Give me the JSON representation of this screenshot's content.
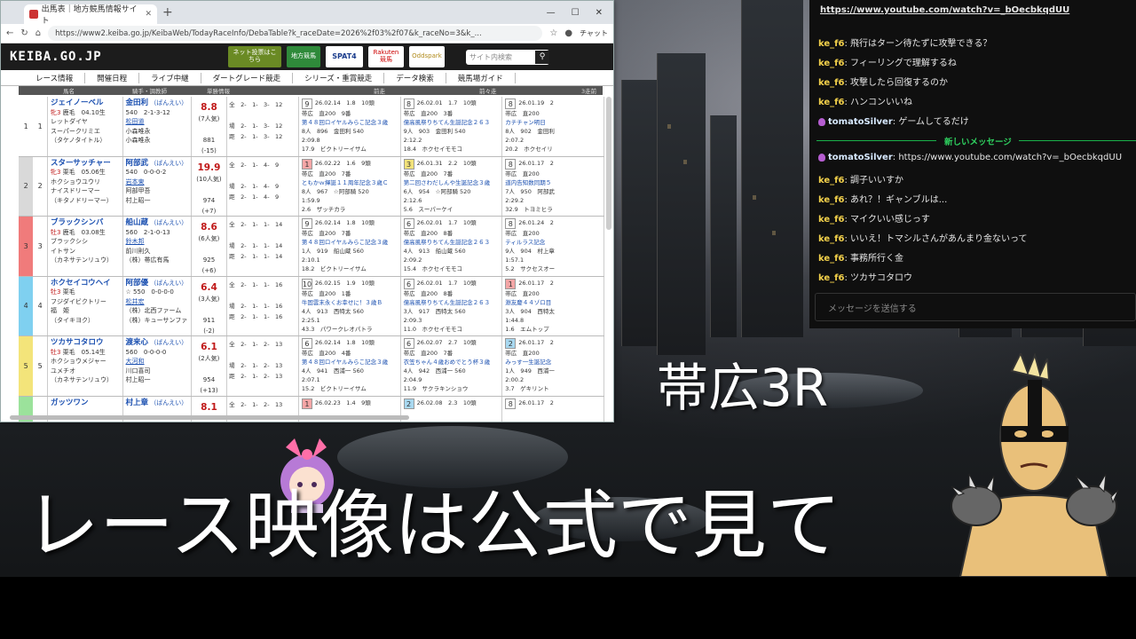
{
  "browser": {
    "tab_title": "出馬表｜地方競馬情報サイト",
    "url": "https://www2.keiba.go.jp/KeibaWeb/TodayRaceInfo/DebaTable?k_raceDate=2026%2f03%2f07&k_raceNo=3&k_...",
    "chat_label": "チャット"
  },
  "site": {
    "logo": "KEIBA.GO.JP",
    "banners": [
      "ネット投票はこちら",
      "地方競馬",
      "SPAT4",
      "Rakuten 競馬",
      "Oddspark"
    ],
    "search_placeholder": "サイト内検索",
    "nav": [
      "レース情報",
      "開催日程",
      "ライブ中継",
      "ダートグレード競走",
      "シリーズ・重賞競走",
      "データ検索",
      "競馬場ガイド"
    ],
    "table_head": [
      "馬名",
      "騎手・調教師",
      "単勝情報",
      "前走",
      "前々走",
      "3走前"
    ]
  },
  "horses": [
    {
      "waku": "1",
      "num": "1",
      "name": "ジェイノーベル",
      "sex_age": "牝3",
      "color_date": "鹿毛　04.10生",
      "sire": "レットダイヤ",
      "dam": "スーパークリミエ",
      "damsire": "（タケノタイトル）",
      "jockey": "金田利",
      "jkana": "（ばんえい）",
      "weight": "540　2-1-3-12",
      "trainer": "松田道",
      "owner": "小森唯永",
      "breeder": "小森唯永",
      "odds": "8.8",
      "pop": "(7人気)",
      "bw": "881",
      "bwd": "(-15)",
      "rec": "全　2-　1-　3-　12\n\n場　2-　1-　3-　12\n距　2-　1-　3-　12",
      "p1": {
        "n": "9",
        "c": "#ffffff",
        "d": "26.02.14　1.8　10頭",
        "t": "帯広　直200　9番",
        "race": "第４８回ロイヤルみらこ記念３歳",
        "w": "8人　896　金田利 540",
        "time": "2:09.8",
        "win": "17.9　ビクトリーイサム"
      },
      "p2": {
        "n": "8",
        "c": "#ffffff",
        "d": "26.02.01　1.7　10頭",
        "t": "帯広　直200　3番",
        "race": "億高風祭りちてん生誕記念２６３",
        "w": "9人　903　金田利 540",
        "time": "2:12.2",
        "win": "18.4　ホクセイモモコ"
      },
      "p3": {
        "n": "8",
        "c": "#ffffff",
        "d": "26.01.19　2",
        "t": "帯広　直200",
        "race": "カチチャン明日",
        "w": "8人　902　金田利",
        "time": "2:07.2",
        "win": "20.2　ホクセイリ"
      }
    },
    {
      "waku": "2",
      "num": "2",
      "name": "スターサッチャー",
      "sex_age": "牝3",
      "color_date": "栗毛　05.06生",
      "sire": "ホクショウユウリ",
      "dam": "ナイスドリーマー",
      "damsire": "（キタノドリーマー）",
      "jockey": "阿部武",
      "jkana": "（ばんえい）",
      "weight": "540　0-0-0-2",
      "trainer": "岩本東",
      "owner": "阿部甲吾",
      "breeder": "村上昭一",
      "odds": "19.9",
      "pop": "(10人気)",
      "bw": "974",
      "bwd": "(+7)",
      "rec": "全　2-　1-　4-　9\n\n場　2-　1-　4-　9\n距　2-　1-　4-　9",
      "p1": {
        "n": "1",
        "c": "#f4a6a6",
        "d": "26.02.22　1.6　9頭",
        "t": "帯広　直200　7番",
        "race": "ともかｗ揮誕１１周年記念３歳Ｃ",
        "w": "8人　967　☆阿部騎 520",
        "time": "1:59.9",
        "win": "2.6　ザッチカラ"
      },
      "p2": {
        "n": "3",
        "c": "#f2e27a",
        "d": "26.01.31　2.2　10頭",
        "t": "帯広　直200　7番",
        "race": "第二回さわだしんや生誕記念３歳",
        "w": "6人　954　☆阿部騎 520",
        "time": "2:12.6",
        "win": "5.6　スーパーケイ"
      },
      "p3": {
        "n": "8",
        "c": "#ffffff",
        "d": "26.01.17　2",
        "t": "帯広　直200",
        "race": "道内告知数同期５",
        "w": "7人　950　阿部武",
        "time": "2:29.2",
        "win": "32.9　トヨミヒラ"
      }
    },
    {
      "waku": "3",
      "num": "3",
      "name": "ブラックシンバ",
      "sex_age": "牡3",
      "color_date": "鹿毛　03.08生",
      "sire": "ブラックシシ",
      "dam": "イトサン",
      "damsire": "（カネサテンリュウ）",
      "jockey": "船山蔵",
      "jkana": "（ばんえい）",
      "weight": "560　2-1-0-13",
      "trainer": "鈴木邦",
      "owner": "前川則久",
      "breeder": "（株）帯広有馬",
      "odds": "8.6",
      "pop": "(6人気)",
      "bw": "925",
      "bwd": "(+6)",
      "rec": "全　2-　1-　1-　14\n\n場　2-　1-　1-　14\n距　2-　1-　1-　14",
      "p1": {
        "n": "9",
        "c": "#ffffff",
        "d": "26.02.14　1.8　10頭",
        "t": "帯広　直200　7番",
        "race": "第４８回ロイヤルみらこ記念３歳",
        "w": "1人　919　船山蔵 560",
        "time": "2:10.1",
        "win": "18.2　ビクトリーイサム"
      },
      "p2": {
        "n": "6",
        "c": "#ffffff",
        "d": "26.02.01　1.7　10頭",
        "t": "帯広　直200　8番",
        "race": "億高風祭りちてん生誕記念２６３",
        "w": "4人　913　船山蔵 560",
        "time": "2:09.2",
        "win": "15.4　ホクセイモモコ"
      },
      "p3": {
        "n": "8",
        "c": "#ffffff",
        "d": "26.01.24　2",
        "t": "帯広　直200",
        "race": "ティルラス記念",
        "w": "9人　904　村上章",
        "time": "1:57.1",
        "win": "5.2　サクセスオー"
      }
    },
    {
      "waku": "4",
      "num": "4",
      "name": "ホクセイコウヘイ",
      "sex_age": "牡3",
      "color_date": "栗毛",
      "sire": "フジダイビクトリー",
      "dam": "福　姫",
      "damsire": "（タイキヨク）",
      "jockey": "阿部優",
      "jkana": "（ばんえい）",
      "weight": "☆ 550　0-0-0-0",
      "trainer": "松井宏",
      "owner": "（株）北西ファーム",
      "breeder": "（株）キューサンファ",
      "odds": "6.4",
      "pop": "(3人気)",
      "bw": "911",
      "bwd": "(-2)",
      "rec": "全　2-　1-　1-　16\n\n場　2-　1-　1-　16\n距　2-　1-　1-　16",
      "p1": {
        "n": "10",
        "c": "#ffffff",
        "d": "26.02.15　1.9　10頭",
        "t": "帯広　直200　1番",
        "race": "牛固雲末永くお幸せに！３歳Ｂ",
        "w": "4人　913　西特太 560",
        "time": "2:25.1",
        "win": "43.3　パワークレオパトラ"
      },
      "p2": {
        "n": "6",
        "c": "#ffffff",
        "d": "26.02.01　1.7　10頭",
        "t": "帯広　直200　8番",
        "race": "億高風祭りちてん生誕記念２６３",
        "w": "3人　917　西特太 560",
        "time": "2:09.3",
        "win": "11.0　ホクセイモモコ"
      },
      "p3": {
        "n": "1",
        "c": "#f4a6a6",
        "d": "26.01.17　2",
        "t": "帯広　直200",
        "race": "淵友慶４４ゾロ目",
        "w": "3人　904　西特太",
        "time": "1:44.8",
        "win": "1.6　エムトップ"
      }
    },
    {
      "waku": "5",
      "num": "5",
      "name": "ツカサコタロウ",
      "sex_age": "牡3",
      "color_date": "栗毛　05.14生",
      "sire": "ホクショウメジャー",
      "dam": "ユメチオ",
      "damsire": "（カネサテンリュウ）",
      "jockey": "渡来心",
      "jkana": "（ばんえい）",
      "weight": "560　0-0-0-0",
      "trainer": "大河和",
      "owner": "川口喜司",
      "breeder": "村上昭一",
      "odds": "6.1",
      "pop": "(2人気)",
      "bw": "954",
      "bwd": "(+13)",
      "rec": "全　2-　1-　2-　13\n\n場　2-　1-　2-　13\n距　2-　1-　2-　13",
      "p1": {
        "n": "6",
        "c": "#ffffff",
        "d": "26.02.14　1.8　10頭",
        "t": "帯広　直200　4番",
        "race": "第４８回ロイヤルみらこ記念３歳",
        "w": "4人　941　西浦一 560",
        "time": "2:07.1",
        "win": "15.2　ビクトリーイサム"
      },
      "p2": {
        "n": "6",
        "c": "#ffffff",
        "d": "26.02.07　2.7　10頭",
        "t": "帯広　直200　7番",
        "race": "衣笠ちゃん４歳おめでとう杯３歳",
        "w": "4人　942　西浦一 560",
        "time": "2:04.9",
        "win": "11.9　サクラキンショウ"
      },
      "p3": {
        "n": "2",
        "c": "#a8d8f0",
        "d": "26.01.17　2",
        "t": "帯広　直200",
        "race": "みっす一生誕記念",
        "w": "1人　949　西浦一",
        "time": "2:00.2",
        "win": "3.7　ゲキリント"
      }
    },
    {
      "waku": "6",
      "num": "6",
      "name": "ガッツワン",
      "sex_age": "",
      "color_date": "",
      "sire": "",
      "dam": "",
      "damsire": "",
      "jockey": "村上章",
      "jkana": "（ばんえい）",
      "weight": "",
      "trainer": "",
      "owner": "",
      "breeder": "",
      "odds": "8.1",
      "pop": "",
      "bw": "",
      "bwd": "",
      "rec": "全　2-　1-　2-　13",
      "p1": {
        "n": "1",
        "c": "#f4a6a6",
        "d": "26.02.23　1.4　9頭",
        "t": "",
        "race": "",
        "w": "",
        "time": "",
        "win": ""
      },
      "p2": {
        "n": "2",
        "c": "#a8d8f0",
        "d": "26.02.08　2.3　10頭",
        "t": "",
        "race": "",
        "w": "",
        "time": "",
        "win": ""
      },
      "p3": {
        "n": "8",
        "c": "#ffffff",
        "d": "26.01.17　2",
        "t": "",
        "race": "",
        "w": "",
        "time": "",
        "win": ""
      }
    }
  ],
  "chat": {
    "top_link": "https://www.youtube.com/watch?v=_bOecbkqdUU",
    "messages": [
      {
        "user": "ke_f6",
        "text": "飛行はターン待たずに攻撃できる？"
      },
      {
        "user": "ke_f6",
        "text": "フィーリングで理解するね"
      },
      {
        "user": "ke_f6",
        "text": "攻撃したら回復するのか"
      },
      {
        "user": "ke_f6",
        "text": "ハンコンいいね"
      },
      {
        "user": "tomatoSilver",
        "text": "ゲームしてるだけ"
      }
    ],
    "divider": "新しいメッセージ",
    "messages2": [
      {
        "user": "tomatoSilver",
        "text": "https://www.youtube.com/watch?v=_bOecbkqdUU"
      },
      {
        "user": "ke_f6",
        "text": "調子いいすか"
      },
      {
        "user": "ke_f6",
        "text": "あれ？！ギャンブルは..."
      },
      {
        "user": "ke_f6",
        "text": "マイクいい感じっす"
      },
      {
        "user": "ke_f6",
        "text": "いいえ！トマシルさんがあんまり金ないって"
      },
      {
        "user": "ke_f6",
        "text": "事務所行く金"
      },
      {
        "user": "ke_f6",
        "text": "ツカサコタロウ"
      }
    ],
    "input_placeholder": "メッセージを送信する"
  },
  "overlay": {
    "subtitle": "帯広3R",
    "caption": "レース映像は公式で見て"
  },
  "colors": {
    "waku": [
      "#ffffff",
      "#d9d9d9",
      "#f07b7b",
      "#7fd0f0",
      "#f3e47a",
      "#9be29b"
    ],
    "username": "#f3d14b",
    "divider": "#2ed15f"
  }
}
